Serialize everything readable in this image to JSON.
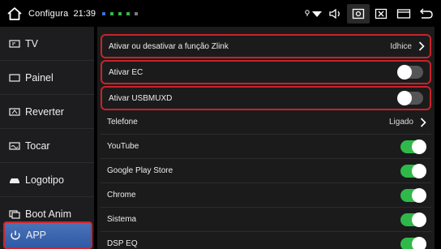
{
  "statusbar": {
    "title": "Configura",
    "time": "21:39",
    "dot_colors": [
      "#3b6fd4",
      "#2fb94a",
      "#2fb94a",
      "#2fb94a",
      "#7a7a7a"
    ],
    "icons": [
      "location-wifi-icon",
      "volume-icon",
      "screenshot-icon",
      "close-window-icon",
      "multiwindow-icon",
      "back-icon"
    ]
  },
  "sidebar": {
    "items": [
      {
        "label": "TV",
        "icon": "tv-icon"
      },
      {
        "label": "Painel",
        "icon": "panel-icon"
      },
      {
        "label": "Reverter",
        "icon": "reverse-camera-icon"
      },
      {
        "label": "Tocar",
        "icon": "touch-icon"
      },
      {
        "label": "Logotipo",
        "icon": "car-logo-icon"
      },
      {
        "label": "Boot Anim",
        "icon": "boot-anim-icon"
      },
      {
        "label": "APP",
        "icon": "app-icon"
      }
    ],
    "selected": "APP"
  },
  "rows": [
    {
      "label": "Ativar ou desativar a função Zlink",
      "value": "Idhice",
      "kind": "chevron",
      "highlighted": true
    },
    {
      "label": "Ativar EC",
      "kind": "toggle",
      "on": false,
      "highlighted": true
    },
    {
      "label": "Ativar USBMUXD",
      "kind": "toggle",
      "on": false,
      "highlighted": true
    },
    {
      "label": "Telefone",
      "value": "Ligado",
      "kind": "chevron",
      "highlighted": false
    },
    {
      "label": "YouTube",
      "kind": "toggle",
      "on": true,
      "highlighted": false
    },
    {
      "label": "Google Play Store",
      "kind": "toggle",
      "on": true,
      "highlighted": false
    },
    {
      "label": "Chrome",
      "kind": "toggle",
      "on": true,
      "highlighted": false
    },
    {
      "label": "Sistema",
      "kind": "toggle",
      "on": true,
      "highlighted": false
    },
    {
      "label": "DSP EQ",
      "kind": "toggle",
      "on": true,
      "highlighted": false
    }
  ],
  "colors": {
    "accent_red": "#c8232a",
    "toggle_on": "#2fb94a",
    "toggle_off": "#555555",
    "selected_blue": "#3a66b0"
  }
}
